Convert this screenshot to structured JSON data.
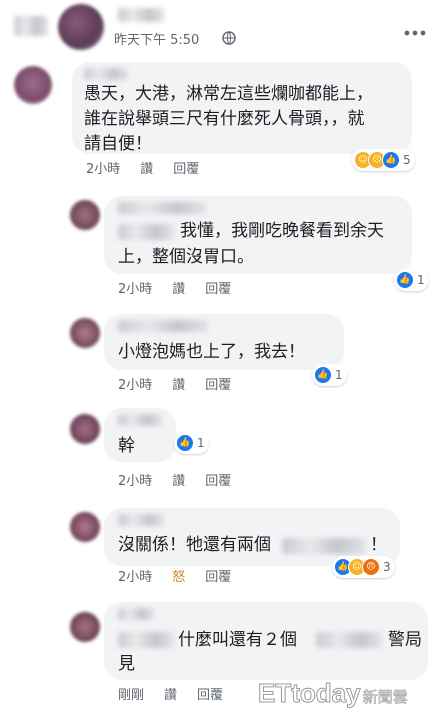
{
  "post": {
    "time": "昨天下午 5:50",
    "privacy_icon": "globe-icon",
    "more_icon": "ellipsis-icon"
  },
  "comments": [
    {
      "text_lines": [
        "愚天，大港，淋常左這些爛咖都能上，",
        "誰在說舉頭三尺有什麼死人骨頭，，就",
        "請自便！"
      ],
      "time": "2小時",
      "like": "讚",
      "reply": "回覆",
      "reactions": [
        "haha-icon",
        "sad-icon",
        "like-icon"
      ],
      "reaction_count": "5"
    },
    {
      "text_lines": [
        "我懂，我剛吃晚餐看到余天",
        "上，整個沒胃口。"
      ],
      "time": "2小時",
      "like": "讚",
      "reply": "回覆",
      "reactions": [
        "like-icon"
      ],
      "reaction_count": "1"
    },
    {
      "text_lines": [
        "小燈泡媽也上了，我去！"
      ],
      "time": "2小時",
      "like": "讚",
      "reply": "回覆",
      "reactions": [
        "like-icon"
      ],
      "reaction_count": "1"
    },
    {
      "text_lines": [
        "幹"
      ],
      "time": "2小時",
      "like": "讚",
      "reply": "回覆",
      "reactions": [
        "like-icon"
      ],
      "reaction_count": "1"
    },
    {
      "text_lines": [
        "沒關係！牠還有兩個",
        "！"
      ],
      "time": "2小時",
      "like": "怒",
      "reply": "回覆",
      "reactions": [
        "like-icon",
        "haha-icon",
        "angry-icon"
      ],
      "reaction_count": "3"
    },
    {
      "text_lines": [
        "什麼叫還有２個",
        "警局",
        "見"
      ],
      "time": "剛剛",
      "like": "讚",
      "reply": "回覆"
    }
  ],
  "watermark": {
    "brand": "ETtoday",
    "suffix": "新聞雲"
  },
  "colors": {
    "bubble": "#f2f3f5",
    "like_blue": "#1877f2",
    "meta_gray": "#606770",
    "angry_label": "#d1842a"
  }
}
